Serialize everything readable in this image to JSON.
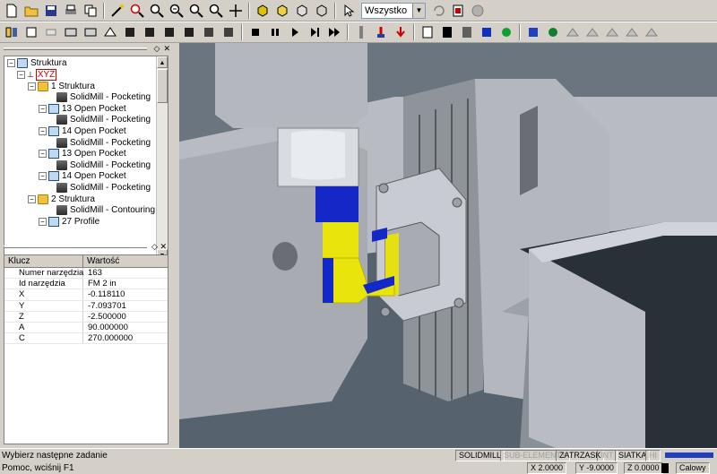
{
  "toolbar": {
    "selection_combo": "Wszystko",
    "icons_row1": [
      "new-file-icon",
      "open-folder-icon",
      "save-icon",
      "print-icon",
      "copy-icon",
      "wand-icon",
      "zoom-in-icon",
      "zoom-icon",
      "zoom-out-icon",
      "zoom-window-icon",
      "zoom-fit-icon",
      "pan-icon",
      "shade-icon",
      "solid-icon",
      "wireframe-icon",
      "hidden-icon",
      "select-arrow-icon",
      "undo-icon",
      "paste-icon",
      "stop-icon"
    ],
    "icons_row2": [
      "tool-a-icon",
      "tool-b-icon",
      "tool-c-icon",
      "tool-d-icon",
      "tool-e-icon",
      "tool-f-icon",
      "tool-g-icon",
      "tool-h-icon",
      "tool-i-icon",
      "tool-j-icon",
      "tool-k-icon",
      "tool-l-icon",
      "sim-stop-icon",
      "sim-pause-icon",
      "sim-play-icon",
      "sim-step-icon",
      "sim-end-icon",
      "sim-tool-icon",
      "sim-cut-icon",
      "sim-down-icon",
      "view-a-icon",
      "view-b-icon",
      "view-c-icon",
      "view-d-icon",
      "view-e-icon",
      "view-f-icon",
      "view-g-icon",
      "view-h-icon"
    ]
  },
  "tree": {
    "root": "Struktura",
    "xyz": "XYZ",
    "items": [
      {
        "label": "1 Struktura",
        "type": "folder"
      },
      {
        "label": "SolidMill - Pocketing",
        "type": "mill"
      },
      {
        "label": "13 Open Pocket",
        "type": "pocket"
      },
      {
        "label": "SolidMill - Pocketing",
        "type": "mill"
      },
      {
        "label": "14 Open Pocket",
        "type": "pocket"
      },
      {
        "label": "SolidMill - Pocketing",
        "type": "mill"
      },
      {
        "label": "13 Open Pocket",
        "type": "pocket"
      },
      {
        "label": "SolidMill - Pocketing",
        "type": "mill"
      },
      {
        "label": "14 Open Pocket",
        "type": "pocket"
      },
      {
        "label": "SolidMill - Pocketing",
        "type": "mill"
      },
      {
        "label": "2 Struktura",
        "type": "folder"
      },
      {
        "label": "SolidMill - Contouring",
        "type": "mill"
      },
      {
        "label": "27 Profile",
        "type": "pocket"
      }
    ]
  },
  "props": {
    "col_key": "Klucz",
    "col_value": "Wartość",
    "rows": [
      {
        "k": "Numer narzędzia",
        "v": "163"
      },
      {
        "k": "Id narzędzia",
        "v": "FM 2 in"
      },
      {
        "k": "X",
        "v": "-0.118110"
      },
      {
        "k": "Y",
        "v": "-7.093701"
      },
      {
        "k": "Z",
        "v": "-2.500000"
      },
      {
        "k": "A",
        "v": "90.000000"
      },
      {
        "k": "C",
        "v": "270.000000"
      }
    ]
  },
  "status": {
    "message": "Wybierz następne zadanie",
    "help": "Pomoc, wciśnij F1",
    "solidmill": "SOLIDMILL",
    "subelementy": "SUB-ELEMENTY",
    "zatrzask": "ZATRZASK",
    "int": "INT",
    "siatka": "SIATKA",
    "hi": "HI",
    "x": "X 2.0000",
    "y": "Y -9.0000",
    "z": "Z 0.0000",
    "units": "Calowy"
  }
}
